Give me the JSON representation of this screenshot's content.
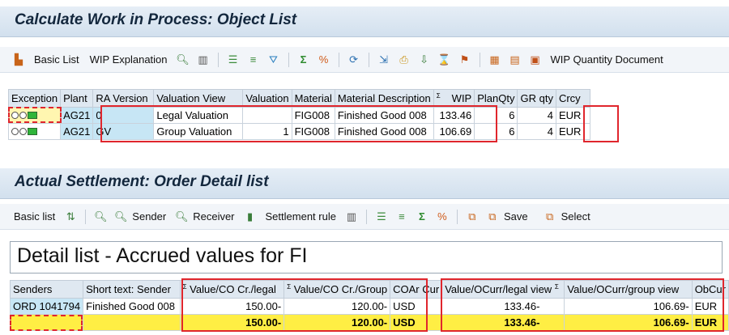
{
  "wip_panel": {
    "title": "Calculate Work in Process: Object List",
    "toolbar": {
      "basic_list": "Basic List",
      "wip_explanation": "WIP Explanation",
      "wip_quantity_document": "WIP Quantity Document"
    },
    "columns": [
      "Exception",
      "Plant",
      "RA Version",
      "Valuation View",
      "Valuation",
      "Material",
      "Material Description",
      "WIP",
      "PlanQty",
      "GR qty",
      "Crcy"
    ],
    "wip_sigma": "Σ",
    "rows": [
      {
        "plant": "AG21",
        "ra_version": "0",
        "valuation_view": "Legal Valuation",
        "valuation": "",
        "material": "FIG008",
        "description": "Finished Good 008",
        "wip": "133.46",
        "plan_qty": "6",
        "gr_qty": "4",
        "crcy": "EUR"
      },
      {
        "plant": "AG21",
        "ra_version": "GV",
        "valuation_view": "Group Valuation",
        "valuation": "1",
        "material": "FIG008",
        "description": "Finished Good 008",
        "wip": "106.69",
        "plan_qty": "6",
        "gr_qty": "4",
        "crcy": "EUR"
      }
    ]
  },
  "settle_panel": {
    "title": "Actual Settlement: Order Detail list",
    "toolbar": {
      "basic_list": "Basic list",
      "sender": "Sender",
      "receiver": "Receiver",
      "settlement_rule": "Settlement rule",
      "save": "Save",
      "select": "Select"
    },
    "detail_title": "Detail list - Accrued values for FI",
    "columns": [
      "Senders",
      "Short text: Sender",
      "Value/CO Cr./legal",
      "Value/CO Cr./Group",
      "COAr Cur",
      "Value/OCurr/legal view",
      "Value/OCurr/group view",
      "ObCur"
    ],
    "sigma": "Σ",
    "row": {
      "sender": "ORD 1041794",
      "short_text": "Finished Good 008",
      "co_legal": "150.00-",
      "co_group": "120.00-",
      "coar_cur": "USD",
      "oc_legal": "133.46-",
      "oc_group": "106.69-",
      "obcur": "EUR"
    },
    "total_row": {
      "co_legal": "150.00-",
      "co_group": "120.00-",
      "coar_cur": "USD",
      "oc_legal": "133.46-",
      "oc_group": "106.69-",
      "obcur": "EUR"
    }
  },
  "colors": {
    "highlight_red": "#e0262d",
    "total_yellow": "#ffee44",
    "key_blue": "#c7e6f5",
    "header_bg": "#dfe8f1"
  }
}
